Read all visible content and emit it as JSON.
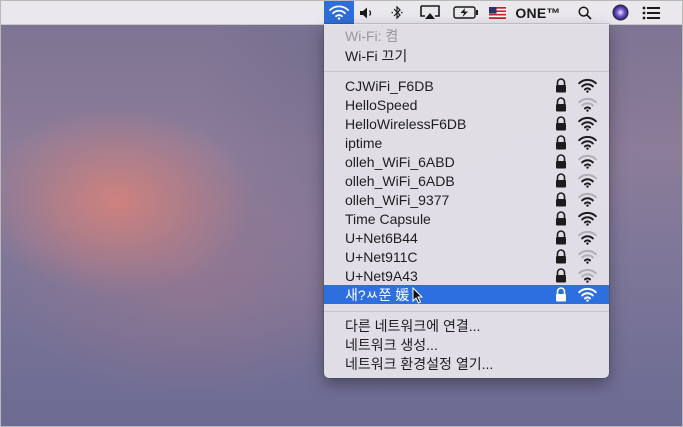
{
  "menubar": {
    "wifi_icon": "wifi-icon",
    "volume_icon": "volume-icon",
    "bluetooth_icon": "bluetooth-icon",
    "airplay_icon": "airplay-icon",
    "battery_icon": "battery-charging-icon",
    "flag_icon": "us-flag-icon",
    "app_label": "ONE™",
    "search_icon": "spotlight-search-icon",
    "siri_icon": "siri-icon",
    "notifications_icon": "notification-center-icon",
    "highlight_color": "#2f6ed8"
  },
  "wifi_menu": {
    "status": "Wi-Fi: 켬",
    "toggle": "Wi-Fi 끄기",
    "networks": [
      {
        "name": "CJWiFi_F6DB",
        "locked": true,
        "signal": 3
      },
      {
        "name": "HelloSpeed",
        "locked": true,
        "signal": 1
      },
      {
        "name": "HelloWirelessF6DB",
        "locked": true,
        "signal": 3
      },
      {
        "name": "iptime",
        "locked": true,
        "signal": 3
      },
      {
        "name": "olleh_WiFi_6ABD",
        "locked": true,
        "signal": 2
      },
      {
        "name": "olleh_WiFi_6ADB",
        "locked": true,
        "signal": 2
      },
      {
        "name": "olleh_WiFi_9377",
        "locked": true,
        "signal": 2
      },
      {
        "name": "Time Capsule",
        "locked": true,
        "signal": 3
      },
      {
        "name": "U+Net6B44",
        "locked": true,
        "signal": 2
      },
      {
        "name": "U+Net911C",
        "locked": true,
        "signal": 1
      },
      {
        "name": "U+Net9A43",
        "locked": true,
        "signal": 1
      },
      {
        "name": "새?ㅆ쭌 媛",
        "locked": true,
        "signal": 3,
        "selected": true
      }
    ],
    "join_other": "다른 네트워크에 연결...",
    "create_network": "네트워크 생성...",
    "open_prefs": "네트워크 환경설정 열기...",
    "selection_color": "#2d6fde"
  }
}
